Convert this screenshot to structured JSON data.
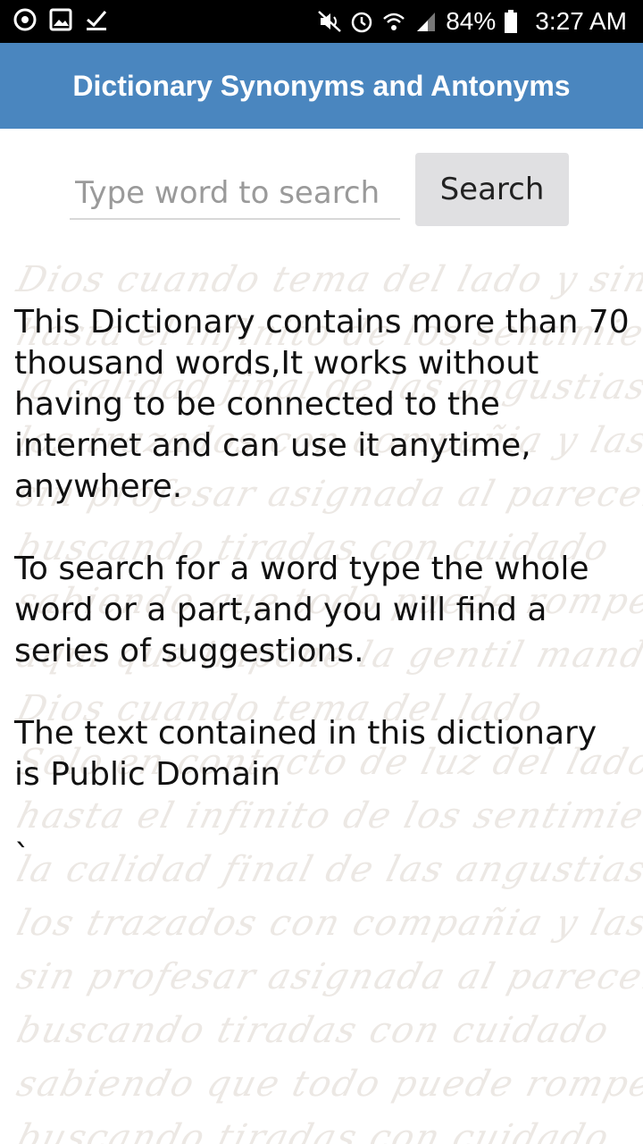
{
  "status_bar": {
    "battery": "84%",
    "time": "3:27 AM"
  },
  "app_bar": {
    "title": "Dictionary Synonyms and Antonyms",
    "color": "#4a86bf"
  },
  "search": {
    "placeholder": "Type word to search",
    "value": "",
    "button_label": "Search"
  },
  "content": {
    "paragraphs": [
      "This Dictionary contains more than 70 thousand words,It works without having to be connected to the internet and can use it anytime, anywhere.",
      "To search for a word type the whole word or a part,and you will find a series of suggestions.",
      "The text contained in this dictionary is Public Domain"
    ],
    "trailing_char": "`"
  },
  "icons": {
    "left": [
      "sync-icon",
      "image-icon",
      "checkmark-icon"
    ],
    "right": [
      "mute-icon",
      "alarm-icon",
      "wifi-icon",
      "signal-icon",
      "battery-icon"
    ]
  }
}
